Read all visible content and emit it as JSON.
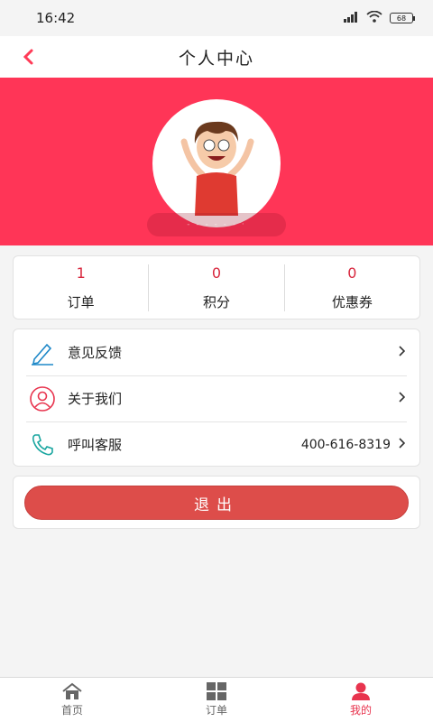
{
  "status_bar": {
    "time": "16:42",
    "battery": "68"
  },
  "nav": {
    "title": "个人中心"
  },
  "profile": {
    "username": "- - - - -  - ·"
  },
  "stats": [
    {
      "value": "1",
      "label": "订单"
    },
    {
      "value": "0",
      "label": "积分"
    },
    {
      "value": "0",
      "label": "优惠券"
    }
  ],
  "menu": [
    {
      "label": "意见反馈",
      "value": "",
      "icon": "pencil-icon"
    },
    {
      "label": "关于我们",
      "value": "",
      "icon": "user-icon"
    },
    {
      "label": "呼叫客服",
      "value": "400-616-8319",
      "icon": "phone-icon"
    }
  ],
  "logout": {
    "label": "退出"
  },
  "tabs": [
    {
      "label": "首页",
      "icon": "home-icon"
    },
    {
      "label": "订单",
      "icon": "grid-icon"
    },
    {
      "label": "我的",
      "icon": "person-icon",
      "active": true
    }
  ],
  "colors": {
    "accent": "#ff3557",
    "logout": "#dd4d4a",
    "active_tab": "#e8344e"
  }
}
